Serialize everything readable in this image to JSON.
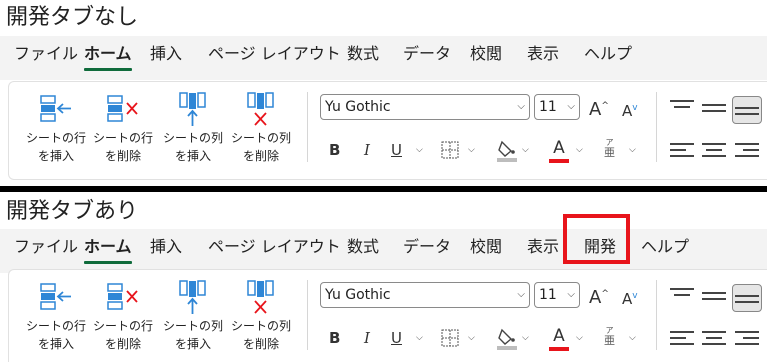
{
  "panels": [
    {
      "title": "開発タブなし",
      "tabs": [
        {
          "label": "ファイル",
          "active": false
        },
        {
          "label": "ホーム",
          "active": true
        },
        {
          "label": "挿入",
          "active": false
        },
        {
          "label": "ページ レイアウト",
          "active": false
        },
        {
          "label": "数式",
          "active": false
        },
        {
          "label": "データ",
          "active": false
        },
        {
          "label": "校閲",
          "active": false
        },
        {
          "label": "表示",
          "active": false
        },
        {
          "label": "ヘルプ",
          "active": false
        }
      ]
    },
    {
      "title": "開発タブあり",
      "tabs": [
        {
          "label": "ファイル",
          "active": false
        },
        {
          "label": "ホーム",
          "active": true
        },
        {
          "label": "挿入",
          "active": false
        },
        {
          "label": "ページ レイアウト",
          "active": false
        },
        {
          "label": "数式",
          "active": false
        },
        {
          "label": "データ",
          "active": false
        },
        {
          "label": "校閲",
          "active": false
        },
        {
          "label": "表示",
          "active": false
        },
        {
          "label": "開発",
          "active": false,
          "highlighted": true
        },
        {
          "label": "ヘルプ",
          "active": false
        }
      ]
    }
  ],
  "commands": [
    {
      "line1": "シートの行",
      "line2": "を挿入",
      "icon": "insert-row-icon"
    },
    {
      "line1": "シートの行",
      "line2": "を削除",
      "icon": "delete-row-icon"
    },
    {
      "line1": "シートの列",
      "line2": "を挿入",
      "icon": "insert-column-icon"
    },
    {
      "line1": "シートの列",
      "line2": "を削除",
      "icon": "delete-column-icon"
    }
  ],
  "font": {
    "name": "Yu Gothic",
    "size": "11"
  },
  "format_glyphs": {
    "bold": "B",
    "italic": "I",
    "underline": "U",
    "font_color": "A",
    "furigana": "亜",
    "furigana_ruby": "ア"
  },
  "colors": {
    "accent": "#0f6b3b",
    "highlight": "#e8141b",
    "font_color_bar": "#e8141b",
    "fill_color_bar": "#bdbdbd",
    "icon_blue": "#2e86d6",
    "delete_red": "#e8141b"
  }
}
